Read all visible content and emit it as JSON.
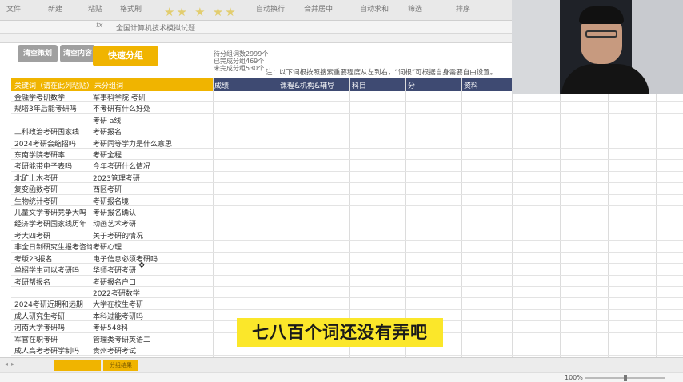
{
  "watermark": "★★ ★ ★★",
  "ribbon": {
    "items": [
      "文件",
      "新建",
      "粘贴",
      "格式刷",
      "自动换行",
      "合并居中",
      "自动求和",
      "筛选",
      "排序"
    ]
  },
  "formula_bar": {
    "fx": "fx",
    "content": "全国计算机技术模拟试题"
  },
  "buttons": {
    "btn1": "清空策划",
    "btn2": "清空内容",
    "btn3": "快速分组"
  },
  "stats": {
    "line1": "待分组词数2999个",
    "line2": "已完成分组469个",
    "line3": "未完成分组530个"
  },
  "note": "注：以下词根按照搜索重要程度从左到右，“词根”可根据自身需要自由设置。",
  "table": {
    "headers": {
      "keyword": "关键词（请在此列粘贴）",
      "ungrouped": "未分组词",
      "c1": "成绩",
      "c2": "课程&机构&辅导",
      "c3": "科目",
      "c4": "分",
      "c5": "资料"
    },
    "rows": [
      [
        "金融学考研数学",
        "军事科学院 考研"
      ],
      [
        "规培3年后能考研吗",
        "不考研有什么好处"
      ],
      [
        "",
        "考研 a线"
      ],
      [
        "工科政治考研国家线",
        "考研报名"
      ],
      [
        "2024考研会缩招吗",
        "考研同等学力是什么意思"
      ],
      [
        "东南学院考研率",
        "考研全程"
      ],
      [
        "考研能带电子表吗",
        "今年考研什么情况"
      ],
      [
        "北矿土木考研",
        "2023管理考研"
      ],
      [
        "复变函数考研",
        "西区考研"
      ],
      [
        "生物统计考研",
        "考研报名境"
      ],
      [
        "儿童文学考研竞争大吗",
        "考研报名确认"
      ],
      [
        "经济学考研国家线历年",
        "动画艺术考研"
      ],
      [
        "考大四考研",
        "关于考研的情况"
      ],
      [
        "非全日制研究生报考咨询",
        "考研心理"
      ],
      [
        "考版23报名",
        "电子信息必须考研吗"
      ],
      [
        "单招学生可以考研吗",
        "华师考研考研"
      ],
      [
        "考研帮报名",
        "考研报名户口"
      ],
      [
        "",
        "2022考研数学"
      ],
      [
        "2024考研近期和远期",
        "大学在校生考研"
      ],
      [
        "成人研究生考研",
        "本科过能考研吗"
      ],
      [
        "河南大学考研吗",
        "考研548科"
      ],
      [
        "军官在职考研",
        "管理类考研英语二"
      ],
      [
        "成人高考考研学制吗",
        "贵州考研考试"
      ]
    ]
  },
  "caption": "七八百个词还没有弄吧",
  "tabs": {
    "tab2": "分组结果"
  },
  "status": {
    "zoom": "100%"
  }
}
